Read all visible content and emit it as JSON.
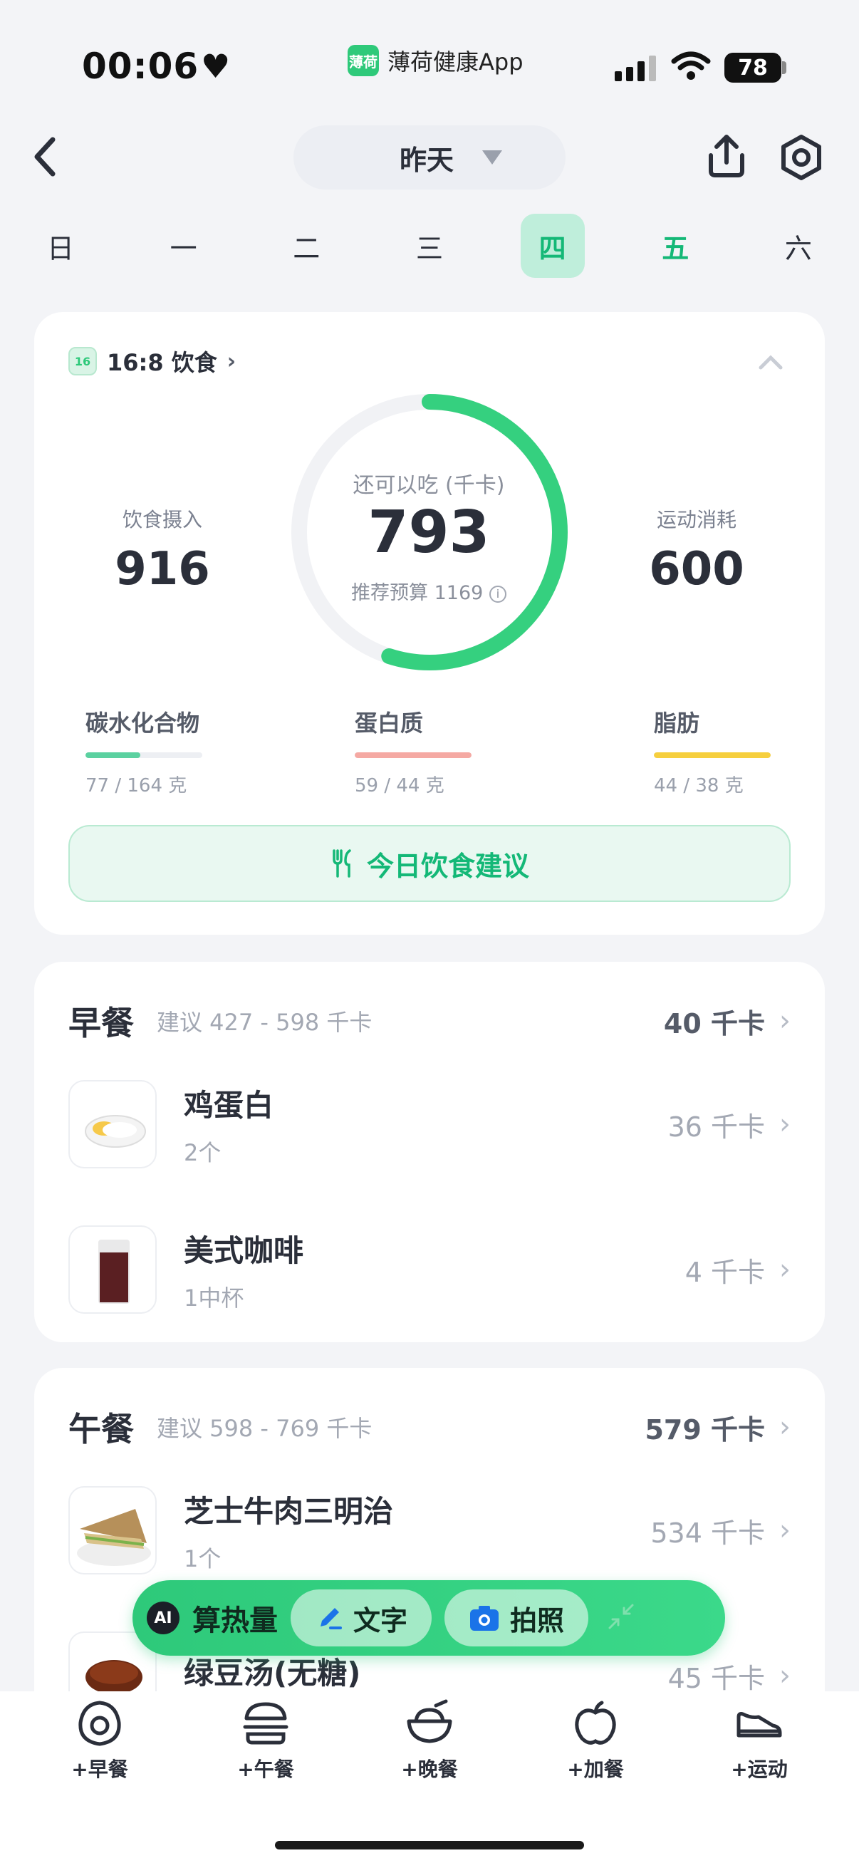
{
  "status": {
    "time": "00:06",
    "app_name": "薄荷健康App",
    "app_badge": "薄荷",
    "battery": "78"
  },
  "header": {
    "date": "昨天"
  },
  "week": {
    "days": [
      "日",
      "一",
      "二",
      "三",
      "四",
      "五",
      "六"
    ],
    "active_index": 4,
    "today_index": 5
  },
  "summary": {
    "diet_mode": "16:8 饮食",
    "intake_label": "饮食摄入",
    "intake_value": "916",
    "remaining_label": "还可以吃 (千卡)",
    "remaining_value": "793",
    "budget_text": "推荐预算 1169",
    "exercise_label": "运动消耗",
    "exercise_value": "600",
    "ring_progress": 0.55,
    "macros": [
      {
        "name": "碳水化合物",
        "value": "77 / 164 克",
        "fraction": 0.47,
        "color": "#5bd1a0"
      },
      {
        "name": "蛋白质",
        "value": "59 / 44 克",
        "fraction": 1.0,
        "color": "#f5a9a3"
      },
      {
        "name": "脂肪",
        "value": "44 / 38 克",
        "fraction": 1.0,
        "color": "#f6cf3e"
      }
    ],
    "advice_label": "今日饮食建议"
  },
  "breakfast": {
    "title": "早餐",
    "suggestion": "建议 427 - 598 千卡",
    "total": "40 千卡",
    "items": [
      {
        "name": "鸡蛋白",
        "amount": "2个",
        "kcal": "36 千卡"
      },
      {
        "name": "美式咖啡",
        "amount": "1中杯",
        "kcal": "4 千卡"
      }
    ]
  },
  "lunch": {
    "title": "午餐",
    "suggestion": "建议 598 - 769 千卡",
    "total": "579 千卡",
    "items": [
      {
        "name": "芝士牛肉三明治",
        "amount": "1个",
        "kcal": "534 千卡"
      },
      {
        "name": "绿豆汤(无糖)",
        "amount": "",
        "kcal": "45 千卡"
      }
    ]
  },
  "ai_bar": {
    "logo": "AI",
    "label": "算热量",
    "text_btn": "文字",
    "photo_btn": "拍照"
  },
  "tabs": [
    {
      "label": "+早餐",
      "icon": "egg-icon"
    },
    {
      "label": "+午餐",
      "icon": "burger-icon"
    },
    {
      "label": "+晚餐",
      "icon": "rice-bowl-icon"
    },
    {
      "label": "+加餐",
      "icon": "apple-icon"
    },
    {
      "label": "+运动",
      "icon": "shoe-icon"
    }
  ]
}
